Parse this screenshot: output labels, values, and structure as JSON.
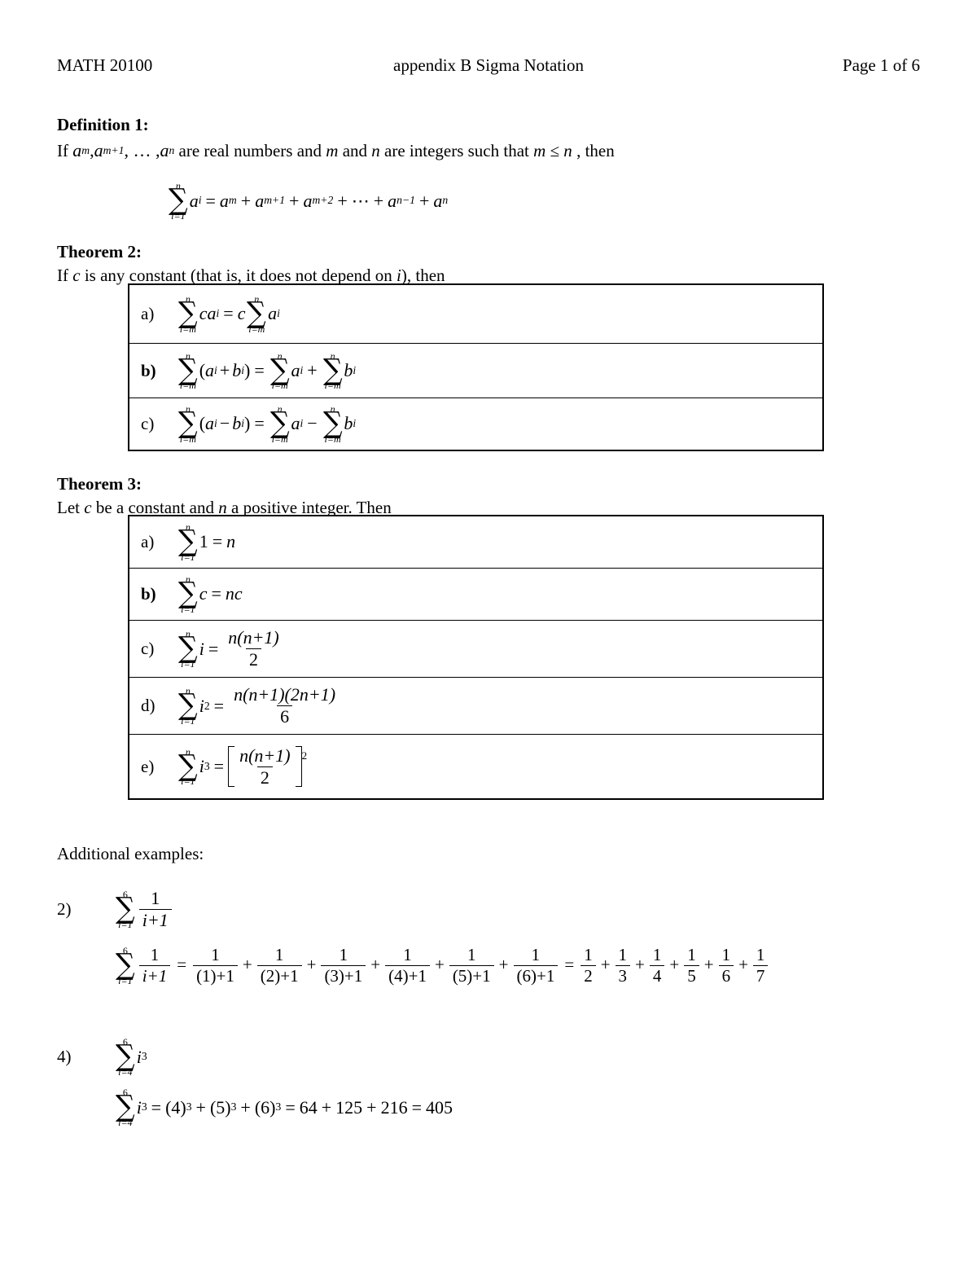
{
  "document": {
    "header": {
      "course": "MATH 20100",
      "title": "appendix B Sigma Notation",
      "page": "Page 1 of 6"
    },
    "definition1": {
      "heading": "Definition 1:",
      "intro_parts": {
        "p1": "If ",
        "a_m": "a",
        "sub_m": "m",
        "comma1": ", ",
        "a_m1": "a",
        "sub_m1": "m+1",
        "ellipsis": ", … , ",
        "a_n": "a",
        "sub_n": "n",
        "p2": " are real numbers and ",
        "m": "m",
        "p3": " and ",
        "n": "n",
        "p4": " are integers such that ",
        "cond": "m ≤ n",
        "p5": " , then"
      },
      "formula": {
        "sum_top": "n",
        "sum_bot": "i=1",
        "term": "a",
        "term_sub": "i",
        "equals": "=",
        "rhs": [
          {
            "base": "a",
            "sub": "m"
          },
          {
            "base": "a",
            "sub": "m+1"
          },
          {
            "base": "a",
            "sub": "m+2"
          },
          {
            "base": "⋯",
            "sub": ""
          },
          {
            "base": "a",
            "sub": "n−1"
          },
          {
            "base": "a",
            "sub": "n"
          }
        ]
      }
    },
    "theorem2": {
      "heading": "Theorem 2:",
      "intro": {
        "p1": "If ",
        "c": "c",
        "p2": " is any constant (that is, it does not depend on ",
        "i": "i",
        "p3": "), then"
      },
      "rows": [
        {
          "label": "a)",
          "bold_label": false,
          "latex": "\\sum_{i=m}^{n} c a_i = c \\sum_{i=m}^{n} a_i",
          "sum_top": "n",
          "sum_bot": "i=m"
        },
        {
          "label": "b)",
          "bold_label": true,
          "latex": "\\sum_{i=m}^{n} (a_i + b_i) = \\sum_{i=m}^{n} a_i + \\sum_{i=m}^{n} b_i",
          "sum_top": "n",
          "sum_bot": "i=m"
        },
        {
          "label": "c)",
          "bold_label": false,
          "latex": "\\sum_{i=m}^{n} (a_i - b_i) = \\sum_{i=m}^{n} a_i - \\sum_{i=m}^{n} b_i",
          "sum_top": "n",
          "sum_bot": "i=m"
        }
      ]
    },
    "theorem3": {
      "heading": "Theorem 3:",
      "intro": {
        "p1": "Let ",
        "c": "c",
        "p2": " be a constant and ",
        "n": "n",
        "p3": " a positive integer.  Then"
      },
      "rows": [
        {
          "label": "a)",
          "bold_label": false,
          "latex": "\\sum_{i=1}^{n} 1 = n",
          "sum_top": "n",
          "sum_bot": "i=1",
          "summand": "1",
          "result": "n"
        },
        {
          "label": "b)",
          "bold_label": true,
          "latex": "\\sum_{i=1}^{n} c = nc",
          "sum_top": "n",
          "sum_bot": "i=1",
          "summand": "c",
          "result": "nc"
        },
        {
          "label": "c)",
          "bold_label": false,
          "latex": "\\sum_{i=1}^{n} i = \\frac{n(n+1)}{2}",
          "sum_top": "n",
          "sum_bot": "i=1",
          "summand": "i",
          "numerator": "n(n+1)",
          "denominator": "2"
        },
        {
          "label": "d)",
          "bold_label": false,
          "latex": "\\sum_{i=1}^{n} i^2 = \\frac{n(n+1)(2n+1)}{6}",
          "sum_top": "n",
          "sum_bot": "i=1",
          "summand": "i",
          "summand_exp": "2",
          "numerator": "n(n+1)(2n+1)",
          "denominator": "6"
        },
        {
          "label": "e)",
          "bold_label": false,
          "latex": "\\sum_{i=1}^{n} i^3 = \\left[\\frac{n(n+1)}{2}\\right]^2",
          "sum_top": "n",
          "sum_bot": "i=1",
          "summand": "i",
          "summand_exp": "3",
          "numerator": "n(n+1)",
          "denominator": "2",
          "bracket_exp": "2"
        }
      ]
    },
    "examples": {
      "heading": "Additional examples:",
      "items": [
        {
          "number": "2)",
          "statement": {
            "sum_top": "6",
            "sum_bot": "i=1",
            "num": "1",
            "den": "i+1"
          },
          "solution": {
            "sum_top": "6",
            "sum_bot": "i=1",
            "num": "1",
            "den": "i+1",
            "expansion_dens": [
              "(1)+1",
              "(2)+1",
              "(3)+1",
              "(4)+1",
              "(5)+1",
              "(6)+1"
            ],
            "expansion_num": "1",
            "simplified": [
              "2",
              "3",
              "4",
              "5",
              "6",
              "7"
            ],
            "simplified_num": "1"
          }
        },
        {
          "number": "4)",
          "statement": {
            "sum_top": "6",
            "sum_bot": "i=4",
            "base": "i",
            "exp": "3"
          },
          "solution": {
            "sum_top": "6",
            "sum_bot": "i=4",
            "base": "i",
            "exp": "3",
            "terms": [
              {
                "base": "(4)",
                "exp": "3"
              },
              {
                "base": "(5)",
                "exp": "3"
              },
              {
                "base": "(6)",
                "exp": "3"
              }
            ],
            "values": [
              "64",
              "125",
              "216"
            ],
            "total": "405"
          }
        }
      ]
    },
    "symbols": {
      "sigma": "∑",
      "plus": "+",
      "minus": "−",
      "equals": "=",
      "cdots": "⋯",
      "leq": "≤"
    }
  }
}
